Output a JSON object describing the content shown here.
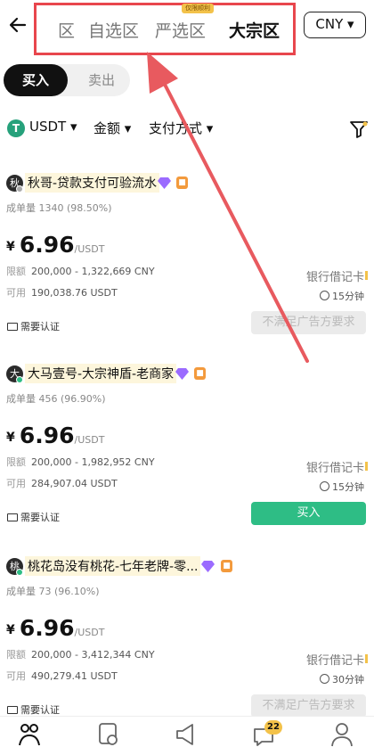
{
  "header": {
    "tabs": [
      "区",
      "自选区",
      "严选区",
      "大宗区"
    ],
    "yanxuan_badge": "仅限顺利",
    "currency": "CNY ▾"
  },
  "trade_side": {
    "buy": "买入",
    "sell": "卖出"
  },
  "filters": {
    "coin_icon": "T",
    "coin": "USDT ▾",
    "amount": "金额 ▾",
    "payment": "支付方式 ▾"
  },
  "ads": [
    {
      "avatar": "秋",
      "avatar_status_color": "#aaaaaa",
      "merchant": "秋哥-贷款支付可验流水",
      "stats": "成单量 1340 (98.50%)",
      "currency_symbol": "¥",
      "price": "6.96",
      "unit": "/USDT",
      "limit_label": "限额",
      "limit": "200,000 - 1,322,669 CNY",
      "available_label": "可用",
      "available": "190,038.76 USDT",
      "payment": "银行借记卡",
      "time": "15分钟",
      "verify": "需要认证",
      "action": "不满足广告方要求",
      "action_enabled": false
    },
    {
      "avatar": "大",
      "avatar_status_color": "#2ebd85",
      "merchant": "大马壹号-大宗神盾-老商家",
      "stats": "成单量 456 (96.90%)",
      "currency_symbol": "¥",
      "price": "6.96",
      "unit": "/USDT",
      "limit_label": "限额",
      "limit": "200,000 - 1,982,952 CNY",
      "available_label": "可用",
      "available": "284,907.04 USDT",
      "payment": "银行借记卡",
      "time": "15分钟",
      "verify": "需要认证",
      "action": "买入",
      "action_enabled": true
    },
    {
      "avatar": "桃",
      "avatar_status_color": "#2ebd85",
      "merchant": "桃花岛没有桃花-七年老牌-零...",
      "stats": "成单量 73 (96.10%)",
      "currency_symbol": "¥",
      "price": "6.96",
      "unit": "/USDT",
      "limit_label": "限额",
      "limit": "200,000 - 3,412,344 CNY",
      "available_label": "可用",
      "available": "490,279.41 USDT",
      "payment": "银行借记卡",
      "time": "30分钟",
      "verify": "需要认证",
      "action": "不满足广告方要求",
      "action_enabled": false
    }
  ],
  "bottom_nav": {
    "icons": [
      "p2p-icon",
      "orders-icon",
      "announcement-icon",
      "chat-icon",
      "profile-icon"
    ],
    "chat_badge": "22"
  },
  "colors": {
    "buy_green": "#2ebd85",
    "highlight_red": "#e8464d",
    "badge_yellow": "#f3c24a",
    "diamond_purple": "#9b6bff"
  }
}
